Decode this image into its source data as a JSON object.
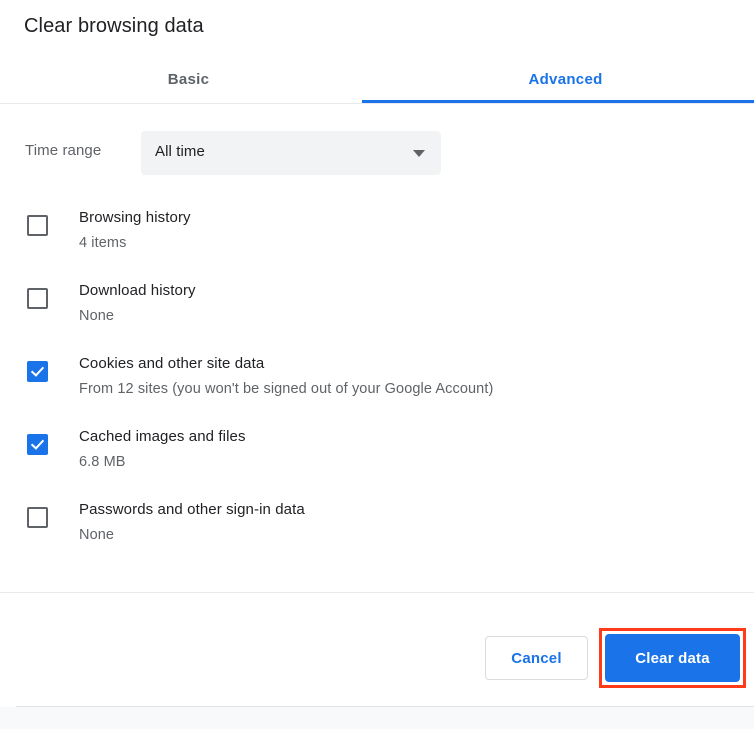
{
  "dialog": {
    "title": "Clear browsing data",
    "tabs": [
      {
        "label": "Basic",
        "active": false
      },
      {
        "label": "Advanced",
        "active": true
      }
    ],
    "time_range": {
      "label": "Time range",
      "value": "All time",
      "dropdown_icon": "chevron-down-icon"
    },
    "items": [
      {
        "title": "Browsing history",
        "subtitle": "4 items",
        "checked": false
      },
      {
        "title": "Download history",
        "subtitle": "None",
        "checked": false
      },
      {
        "title": "Cookies and other site data",
        "subtitle": "From 12 sites (you won't be signed out of your Google Account)",
        "checked": true
      },
      {
        "title": "Cached images and files",
        "subtitle": "6.8 MB",
        "checked": true
      },
      {
        "title": "Passwords and other sign-in data",
        "subtitle": "None",
        "checked": false
      }
    ],
    "footer": {
      "cancel_label": "Cancel",
      "clear_label": "Clear data"
    }
  },
  "colors": {
    "accent_blue": "#1a73e8",
    "text_primary": "#202124",
    "text_secondary": "#5f6368",
    "divider": "#e8eaed",
    "select_bg": "#f1f3f4",
    "highlight_red": "#ff3b19"
  }
}
